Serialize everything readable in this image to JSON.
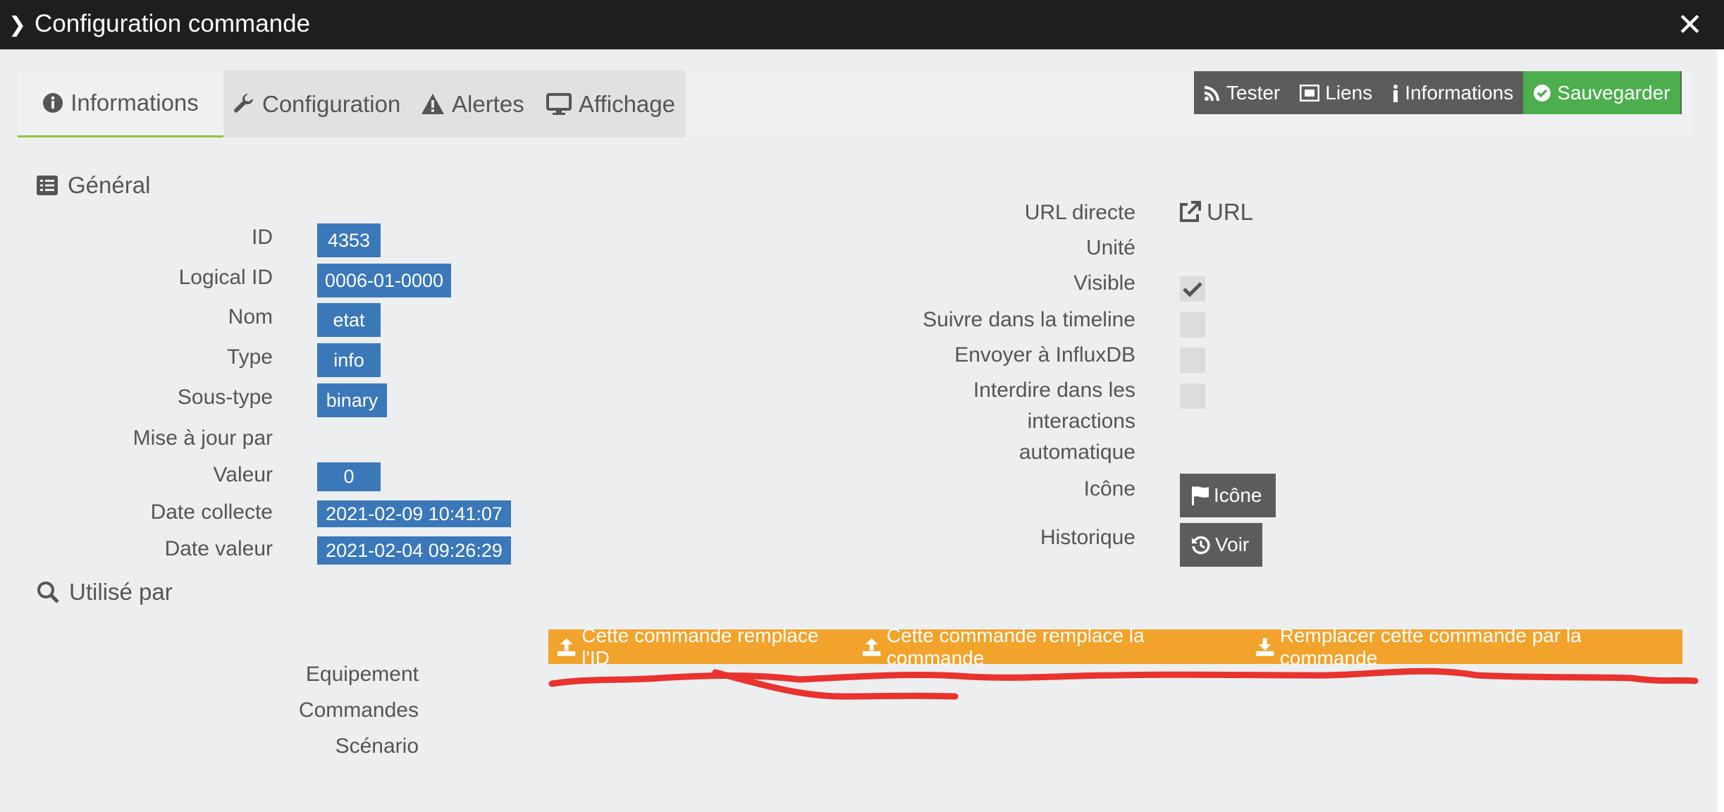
{
  "window": {
    "title": "Configuration commande"
  },
  "tabs": [
    {
      "label": "Informations",
      "icon": "info-circle-icon",
      "active": true
    },
    {
      "label": "Configuration",
      "icon": "wrench-icon"
    },
    {
      "label": "Alertes",
      "icon": "warning-icon"
    },
    {
      "label": "Affichage",
      "icon": "monitor-icon"
    }
  ],
  "toolbar": {
    "tester": "Tester",
    "liens": "Liens",
    "informations": "Informations",
    "sauvegarder": "Sauvegarder"
  },
  "general": {
    "title": "Général",
    "fields": [
      {
        "label": "ID",
        "value": "4353"
      },
      {
        "label": "Logical ID",
        "value": "0006-01-0000"
      },
      {
        "label": "Nom",
        "value": "etat"
      },
      {
        "label": "Type",
        "value": "info"
      },
      {
        "label": "Sous-type",
        "value": "binary"
      },
      {
        "label": "Mise à jour par",
        "value": ""
      },
      {
        "label": "Valeur",
        "value": "0"
      },
      {
        "label": "Date collecte",
        "value": "2021-02-09 10:41:07"
      },
      {
        "label": "Date valeur",
        "value": "2021-02-04 09:26:29"
      }
    ]
  },
  "right": {
    "url_directe": "URL directe",
    "url_link": "URL",
    "unite": "Unité",
    "visible": "Visible",
    "visible_checked": true,
    "timeline": "Suivre dans la timeline",
    "influx": "Envoyer à InfluxDB",
    "interdire_line1": "Interdire dans les",
    "interdire_line2": "interactions",
    "interdire_line3": "automatique",
    "icone": "Icône",
    "icone_button": "Icône",
    "historique": "Historique",
    "voir_button": "Voir"
  },
  "utilise_par": {
    "title": "Utilisé par",
    "equipement": "Equipement",
    "commandes": "Commandes",
    "scenario": "Scénario",
    "actions": {
      "replace_id": "Cette commande remplace l'ID",
      "replace_cmd": "Cette commande remplace la commande",
      "replace_by": "Remplacer cette commande par la commande"
    }
  },
  "colors": {
    "titlebar": "#1e1e1e",
    "badge": "#3a78b9",
    "save": "#4cae4c",
    "orange": "#f1a32c",
    "annotation": "#e8332e",
    "active_tab_underline": "#8cc63f"
  }
}
